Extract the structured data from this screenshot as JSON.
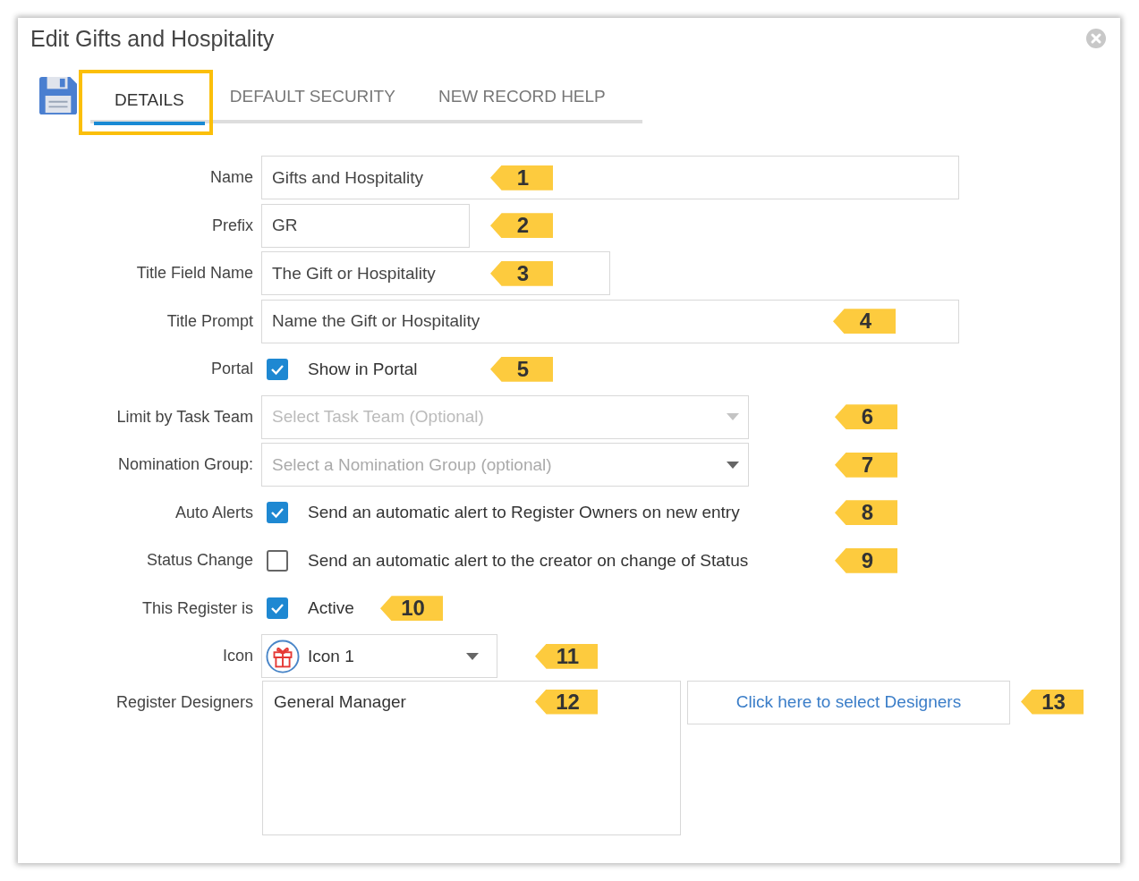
{
  "window": {
    "title": "Edit Gifts and Hospitality"
  },
  "tabs": [
    {
      "label": "DETAILS",
      "selected": true,
      "highlighted": true
    },
    {
      "label": "DEFAULT SECURITY",
      "selected": false,
      "highlighted": false
    },
    {
      "label": "NEW RECORD HELP",
      "selected": false,
      "highlighted": false
    }
  ],
  "fields": [
    {
      "kind": "text",
      "label": "Name",
      "value": "Gifts and Hospitality",
      "callout": "1"
    },
    {
      "kind": "text",
      "label": "Prefix",
      "value": "GR",
      "callout": "2"
    },
    {
      "kind": "text",
      "label": "Title Field Name",
      "value": "The Gift or Hospitality",
      "callout": "3"
    },
    {
      "kind": "text",
      "label": "Title Prompt",
      "value": "Name the Gift or Hospitality",
      "callout": "4"
    },
    {
      "kind": "checkbox",
      "label": "Portal",
      "text": "Show in Portal",
      "checked": true,
      "callout": "5"
    },
    {
      "kind": "select",
      "label": "Limit by Task Team",
      "placeholder": "Select Task Team (Optional)",
      "disabled": true,
      "callout": "6"
    },
    {
      "kind": "select",
      "label": "Nomination Group:",
      "placeholder": "Select a Nomination Group (optional)",
      "disabled": false,
      "callout": "7"
    },
    {
      "kind": "checkbox",
      "label": "Auto Alerts",
      "text": "Send an automatic alert to Register Owners on new entry",
      "checked": true,
      "callout": "8"
    },
    {
      "kind": "checkbox",
      "label": "Status Change",
      "text": "Send an automatic alert to the creator on change of Status",
      "checked": false,
      "callout": "9"
    },
    {
      "kind": "checkbox",
      "label": "This Register is",
      "text": "Active",
      "checked": true,
      "callout": "10"
    },
    {
      "kind": "icon-select",
      "label": "Icon",
      "value": "Icon 1",
      "callout": "11"
    },
    {
      "kind": "designers",
      "label": "Register Designers",
      "value": "General Manager",
      "callout": "12",
      "button": "Click here to select Designers",
      "button_callout": "13"
    }
  ]
}
